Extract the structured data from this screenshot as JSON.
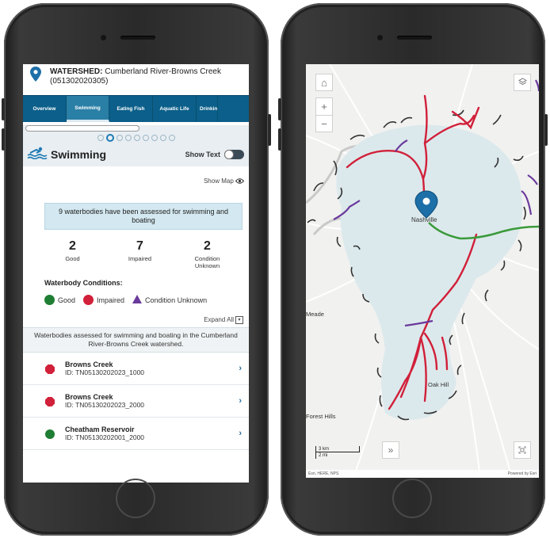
{
  "left": {
    "watershed_label": "WATERSHED:",
    "watershed_name": "Cumberland River-Browns Creek",
    "watershed_code": "(051302020305)",
    "tabs": [
      {
        "label": "Overview"
      },
      {
        "label": "Swimming"
      },
      {
        "label": "Eating Fish"
      },
      {
        "label": "Aquatic Life"
      },
      {
        "label": "Drinking"
      }
    ],
    "section_title": "Swimming",
    "show_text_label": "Show Text",
    "show_map_label": "Show Map",
    "assessed_text": "9 waterbodies have been assessed for swimming and boating",
    "counts": [
      {
        "value": "2",
        "label": "Good"
      },
      {
        "value": "7",
        "label": "Impaired"
      },
      {
        "value": "2",
        "label": "Condition Unknown"
      }
    ],
    "conditions_heading": "Waterbody Conditions:",
    "legend": {
      "good": "Good",
      "impaired": "Impaired",
      "unknown": "Condition Unknown"
    },
    "expand_all": "Expand All",
    "list_description": "Waterbodies assessed for swimming and boating in the Cumberland River-Browns Creek watershed.",
    "waterbodies": [
      {
        "name": "Browns Creek",
        "id": "ID: TN05130202023_1000",
        "status": "impaired"
      },
      {
        "name": "Browns Creek",
        "id": "ID: TN05130202023_2000",
        "status": "impaired"
      },
      {
        "name": "Cheatham Reservoir",
        "id": "ID: TN05130202001_2000",
        "status": "good"
      }
    ],
    "colors": {
      "good": "#1e7e34",
      "impaired": "#d1203a",
      "unknown": "#6a3a9c",
      "tab_bar": "#0b5f8a"
    }
  },
  "right": {
    "labels": {
      "nashville": "Nashville",
      "oak_hill": "Oak Hill",
      "forest_hills": "Forest Hills",
      "meade": "Meade"
    },
    "scale": {
      "km": "3 km",
      "mi": "2 mi"
    },
    "attribution_left": "Esri, HERE, NPS",
    "attribution_right": "Powered by Esri"
  }
}
